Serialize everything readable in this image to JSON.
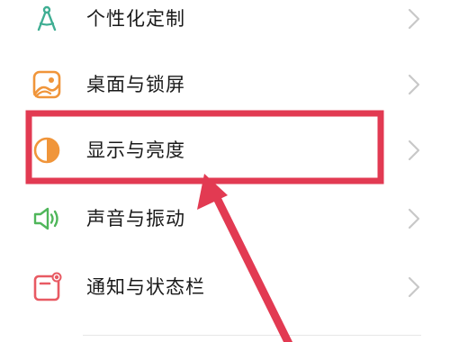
{
  "settings": {
    "items": [
      {
        "label": "个性化定制",
        "icon": "compass-icon"
      },
      {
        "label": "桌面与锁屏",
        "icon": "wallpaper-icon"
      },
      {
        "label": "显示与亮度",
        "icon": "brightness-icon"
      },
      {
        "label": "声音与振动",
        "icon": "speaker-icon"
      },
      {
        "label": "通知与状态栏",
        "icon": "notification-icon"
      }
    ]
  },
  "colors": {
    "icon_teal": "#3fae93",
    "icon_orange": "#f0953a",
    "icon_green": "#4fb65a",
    "icon_red": "#e85a63",
    "annotation_red": "#e23a52",
    "chevron": "#c8c8c8"
  },
  "annotation": {
    "highlighted_item": "显示与亮度"
  }
}
